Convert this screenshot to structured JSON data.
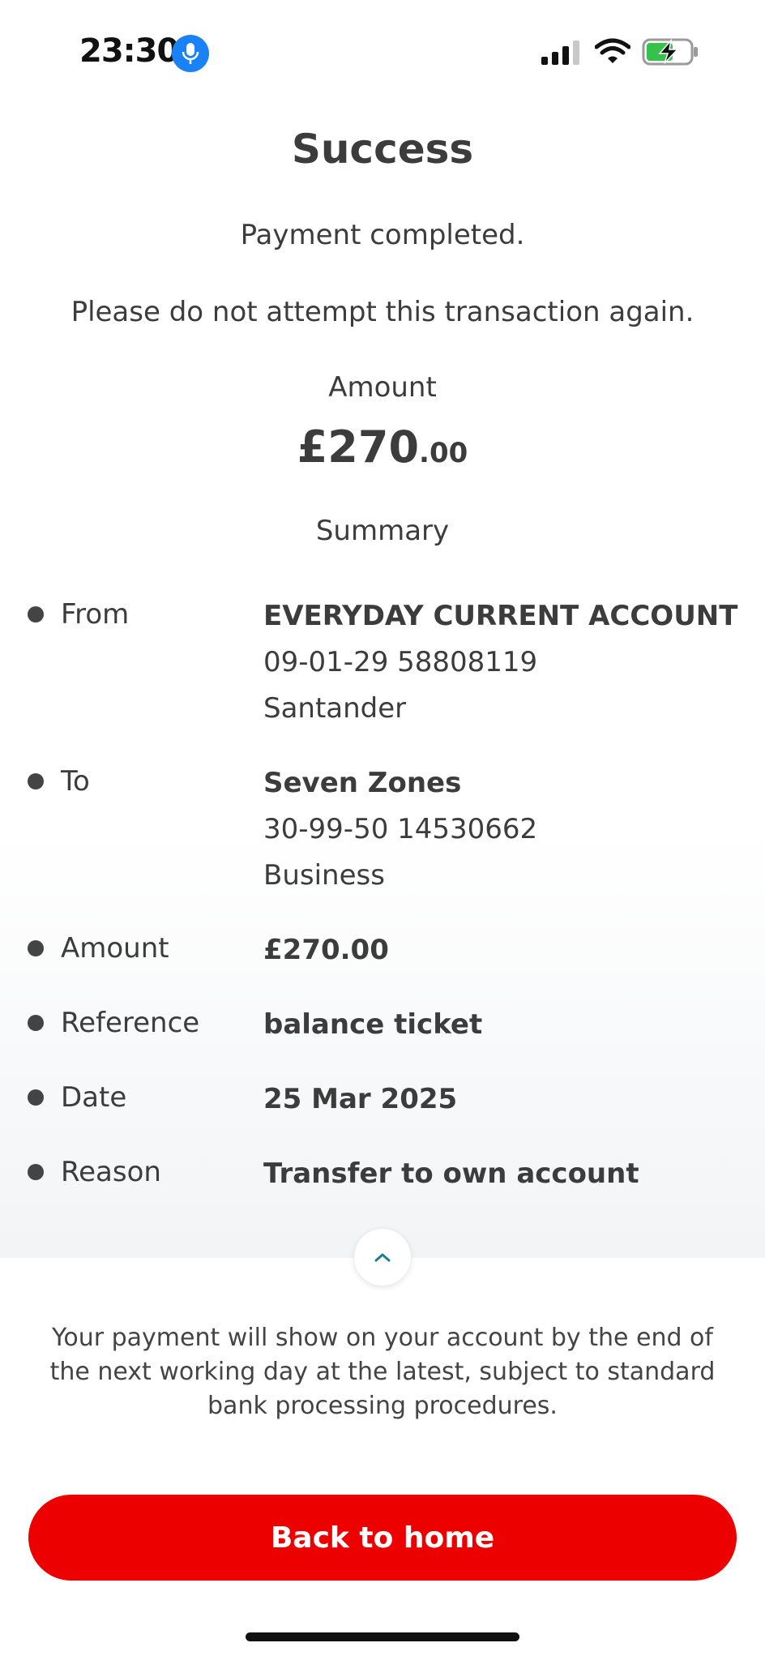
{
  "status_bar": {
    "time": "23:30",
    "icons": [
      "microphone-icon",
      "cellular-signal-icon",
      "wifi-icon",
      "battery-charging-icon"
    ]
  },
  "header": {
    "title": "Success",
    "message": "Payment completed.",
    "warning": "Please do not attempt this transaction again."
  },
  "amount": {
    "label": "Amount",
    "main": "£270",
    "decimals": ".00"
  },
  "summary": {
    "label": "Summary",
    "rows": [
      {
        "label": "From",
        "value": "EVERYDAY CURRENT ACCOUNT",
        "line2": "09-01-29 58808119",
        "line3": "Santander"
      },
      {
        "label": "To",
        "value": "Seven Zones",
        "line2": "30-99-50 14530662",
        "line3": "Business"
      },
      {
        "label": "Amount",
        "value": "£270.00"
      },
      {
        "label": "Reference",
        "value": "balance ticket"
      },
      {
        "label": "Date",
        "value": "25 Mar 2025"
      },
      {
        "label": "Reason",
        "value": "Transfer to own account"
      }
    ]
  },
  "notice": "Your payment will show on your account by the end of the next working day at the latest, subject to standard bank processing procedures.",
  "buttons": {
    "home": "Back to home"
  },
  "colors": {
    "brand_red": "#ec0000",
    "text": "#3c3c3c",
    "chevron": "#1b7f8c",
    "mic_badge": "#1a82f7",
    "battery_green": "#36c24a"
  }
}
